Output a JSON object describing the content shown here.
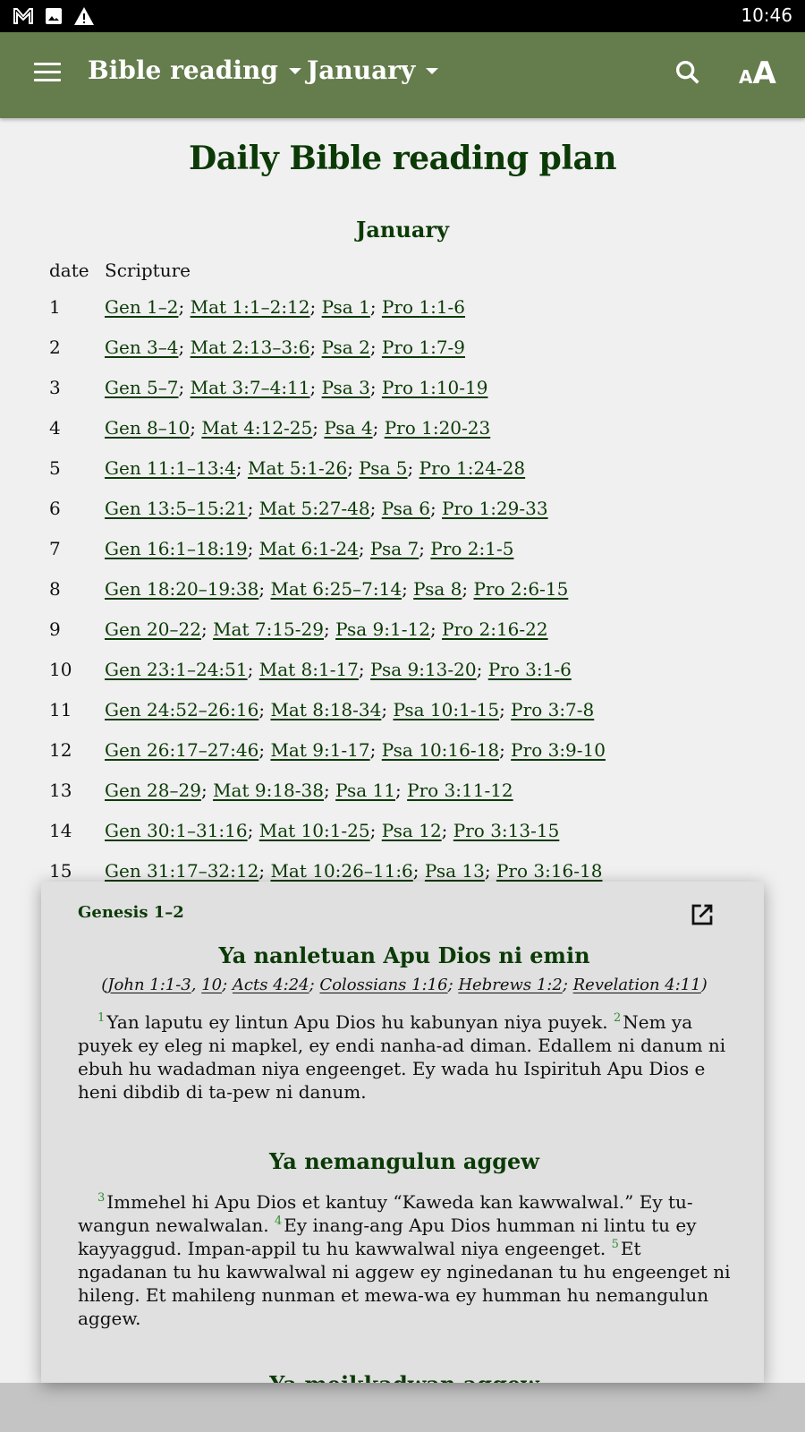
{
  "status_bar": {
    "time": "10:46",
    "icons": [
      "gmail-icon",
      "image-icon",
      "warning-icon"
    ]
  },
  "app_bar": {
    "book_dropdown": "Bible reading",
    "month_dropdown": "January",
    "icons": [
      "menu-icon",
      "search-icon",
      "font-size-icon"
    ],
    "font_icon_small": "A",
    "font_icon_big": "A",
    "background_color": "#657c4c"
  },
  "page": {
    "title": "Daily Bible reading plan",
    "month": "January",
    "columns": [
      "date",
      "Scripture"
    ],
    "rows": [
      {
        "date": "1",
        "refs": [
          "Gen 1–2",
          "Mat 1:1–2:12",
          "Psa 1",
          "Pro 1:1-6"
        ]
      },
      {
        "date": "2",
        "refs": [
          "Gen 3–4",
          "Mat 2:13–3:6",
          "Psa 2",
          "Pro 1:7-9"
        ]
      },
      {
        "date": "3",
        "refs": [
          "Gen 5–7",
          "Mat 3:7–4:11",
          "Psa 3",
          "Pro 1:10-19"
        ]
      },
      {
        "date": "4",
        "refs": [
          "Gen 8–10",
          "Mat 4:12-25",
          "Psa 4",
          "Pro 1:20-23"
        ]
      },
      {
        "date": "5",
        "refs": [
          "Gen 11:1–13:4",
          "Mat 5:1-26",
          "Psa 5",
          "Pro 1:24-28"
        ]
      },
      {
        "date": "6",
        "refs": [
          "Gen 13:5–15:21",
          "Mat 5:27-48",
          "Psa 6",
          "Pro 1:29-33"
        ]
      },
      {
        "date": "7",
        "refs": [
          "Gen 16:1–18:19",
          "Mat 6:1-24",
          "Psa 7",
          "Pro 2:1-5"
        ]
      },
      {
        "date": "8",
        "refs": [
          "Gen 18:20–19:38",
          "Mat 6:25–7:14",
          "Psa 8",
          "Pro 2:6-15"
        ]
      },
      {
        "date": "9",
        "refs": [
          "Gen 20–22",
          "Mat 7:15-29",
          "Psa 9:1-12",
          "Pro 2:16-22"
        ]
      },
      {
        "date": "10",
        "refs": [
          "Gen 23:1–24:51",
          "Mat 8:1-17",
          "Psa 9:13-20",
          "Pro 3:1-6"
        ]
      },
      {
        "date": "11",
        "refs": [
          "Gen 24:52–26:16",
          "Mat 8:18-34",
          "Psa 10:1-15",
          "Pro 3:7-8"
        ]
      },
      {
        "date": "12",
        "refs": [
          "Gen 26:17–27:46",
          "Mat 9:1-17",
          "Psa 10:16-18",
          "Pro 3:9-10"
        ]
      },
      {
        "date": "13",
        "refs": [
          "Gen 28–29",
          "Mat 9:18-38",
          "Psa 11",
          "Pro 3:11-12"
        ]
      },
      {
        "date": "14",
        "refs": [
          "Gen 30:1–31:16",
          "Mat 10:1-25",
          "Psa 12",
          "Pro 3:13-15"
        ]
      },
      {
        "date": "15",
        "refs": [
          "Gen 31:17–32:12",
          "Mat 10:26–11:6",
          "Psa 13",
          "Pro 3:16-18"
        ]
      }
    ]
  },
  "popup": {
    "reference": "Genesis 1–2",
    "open_icon": "open-in-new-icon",
    "sections": [
      {
        "heading": "Ya nanletuan Apu Dios ni emin",
        "cross_refs": [
          "John 1:1-3",
          "10",
          "Acts 4:24",
          "Colossians 1:16",
          "Hebrews 1:2",
          "Revelation 4:11"
        ],
        "verses": [
          {
            "n": "1",
            "text": "Yan laputu ey lintun Apu Dios hu kabunyan niya puyek."
          },
          {
            "n": "2",
            "text": "Nem ya puyek ey eleg ni mapkel, ey endi nanha-ad diman. Edallem ni danum ni ebuh hu wadadman niya engeenget. Ey wada hu Ispirituh Apu Dios e heni dibdib di ta-pew ni danum."
          }
        ]
      },
      {
        "heading": "Ya nemangulun aggew",
        "verses": [
          {
            "n": "3",
            "text": "Immehel hi Apu Dios et kantuy “Kaweda kan kawwalwal.” Ey tu-wangun newalwalan."
          },
          {
            "n": "4",
            "text": "Ey inang-ang Apu Dios humman ni lintu tu ey kayyaggud. Impan-appil tu hu kawwalwal niya engeenget."
          },
          {
            "n": "5",
            "text": "Et ngadanan tu hu kawwalwal ni aggew ey nginedanan tu hu engeenget ni hileng. Et mahileng nunman et mewa-wa ey humman hu nemangulun aggew."
          }
        ]
      },
      {
        "heading": "Ya meikkadwan aggew"
      }
    ]
  }
}
